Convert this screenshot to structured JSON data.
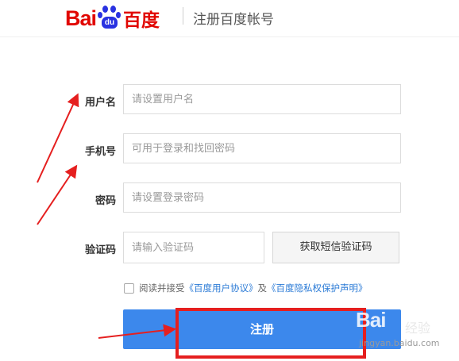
{
  "header": {
    "logo_left": "Bai",
    "logo_paw_text": "du",
    "logo_right": "百度",
    "title": "注册百度帐号"
  },
  "form": {
    "username": {
      "label": "用户名",
      "placeholder": "请设置用户名"
    },
    "phone": {
      "label": "手机号",
      "placeholder": "可用于登录和找回密码"
    },
    "password": {
      "label": "密码",
      "placeholder": "请设置登录密码"
    },
    "captcha": {
      "label": "验证码",
      "placeholder": "请输入验证码",
      "button": "获取短信验证码"
    },
    "agree": {
      "prefix": "阅读并接受",
      "link1": "《百度用户协议》",
      "and": "及",
      "link2": "《百度隐私权保护声明》"
    },
    "submit": "注册"
  },
  "watermark": {
    "logo": "Bai",
    "text": "经验",
    "url": "jingyan.baidu.com"
  },
  "colors": {
    "brand_red": "#e10601",
    "brand_blue": "#2932e1",
    "button_blue": "#3c88ec",
    "annotation_red": "#e51f1f",
    "link_blue": "#2a7ad6"
  }
}
